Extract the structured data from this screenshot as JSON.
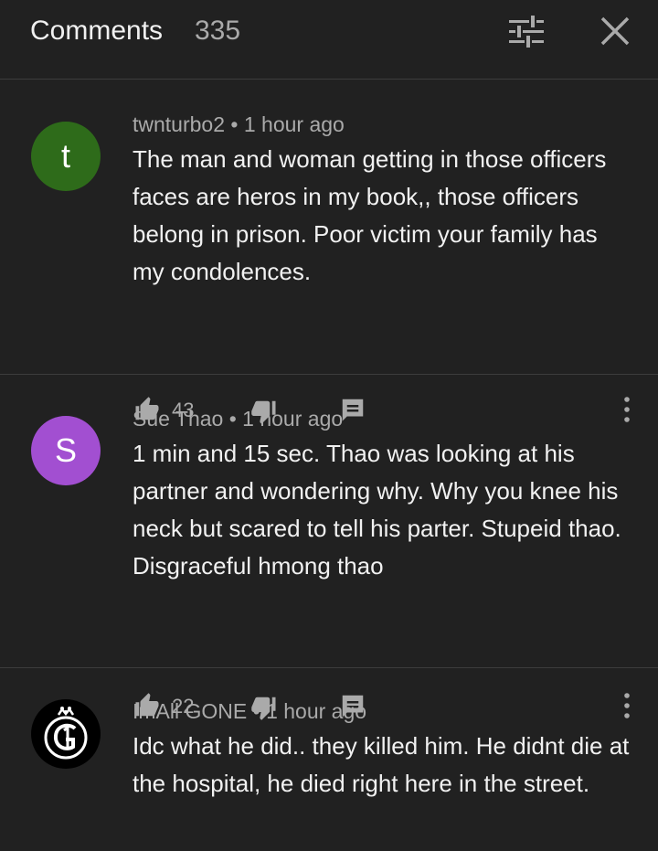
{
  "header": {
    "title": "Comments",
    "count": "335",
    "filter_icon": "filter-sort-icon",
    "close_icon": "close-icon"
  },
  "comments": [
    {
      "avatar_letter": "t",
      "avatar_color": "#2e6b1a",
      "author": "twnturbo2",
      "time": "1 hour ago",
      "text": "The man and woman getting in those officers faces are heros in my book,, those officers belong in prison. Poor victim your family has my condolences.",
      "likes": "43"
    },
    {
      "avatar_letter": "S",
      "avatar_color": "#a24fd1",
      "author": "Sue Thao",
      "time": "1 hour ago",
      "text": "1 min and 15 sec. Thao was looking at his partner and wondering why. Why you knee his neck but scared to tell his parter. Stupeid thao. Disgraceful hmong thao",
      "likes": "22"
    },
    {
      "avatar_letter": "",
      "avatar_color": "#000000",
      "author": "ImAll GONE",
      "time": "1 hour ago",
      "text": "Idc what he did.. they killed him. He didnt die at the hospital, he died right here in the street."
    }
  ],
  "separator": " • "
}
